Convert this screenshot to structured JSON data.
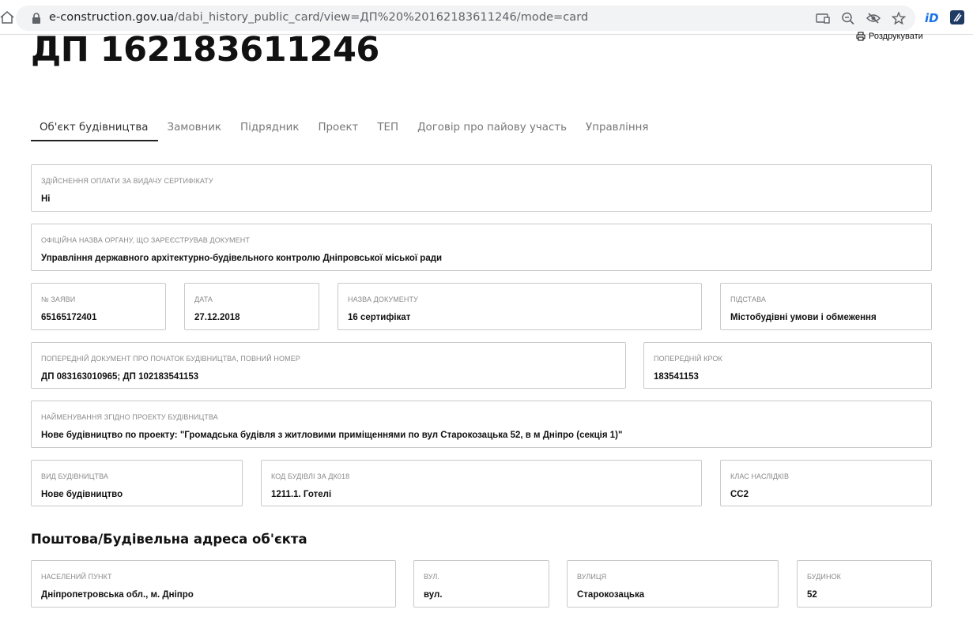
{
  "browser": {
    "url_host": "e-construction.gov.ua",
    "url_path": "/dabi_history_public_card/view=ДП%20%20162183611246/mode=card",
    "ext_icon_1": "iD"
  },
  "page": {
    "title": "ДП 162183611246",
    "print_label": "Роздрукувати"
  },
  "tabs": [
    {
      "label": "Об'єкт будівництва",
      "active": true
    },
    {
      "label": "Замовник"
    },
    {
      "label": "Підрядник"
    },
    {
      "label": "Проект"
    },
    {
      "label": "ТЕП"
    },
    {
      "label": "Договір про пайову участь"
    },
    {
      "label": "Управління"
    }
  ],
  "fields": {
    "payment": {
      "label": "Здійснення оплати за видачу сертифікату",
      "value": "Ні"
    },
    "authority": {
      "label": "Офіційна назва органу, що зареєстрував документ",
      "value": "Управління державного архітектурно-будівельного контролю Дніпровської міської ради"
    },
    "application_no": {
      "label": "№ заяви",
      "value": "65165172401"
    },
    "date": {
      "label": "Дата",
      "value": "27.12.2018"
    },
    "doc_name": {
      "label": "Назва документу",
      "value": "16 сертифікат"
    },
    "basis": {
      "label": "Підстава",
      "value": "Містобудівні умови і обмеження"
    },
    "prev_doc": {
      "label": "Попередній документ про початок будівництва, повний номер",
      "value": "ДП 083163010965; ДП 102183541153"
    },
    "prev_step": {
      "label": "Попередній крок",
      "value": "183541153"
    },
    "project_name": {
      "label": "Найменування згідно проекту будівництва",
      "value": "Нове будівництво по проекту: \"Громадська будівля з житловими приміщеннями по вул Старокозацька 52, в м Дніпро (секція 1)\""
    },
    "construction_type": {
      "label": "Вид будівництва",
      "value": "Нове будівництво"
    },
    "building_code": {
      "label": "Код будівлі за ДК018",
      "value": "1211.1. Готелі"
    },
    "consequence_class": {
      "label": "Клас наслідків",
      "value": "СС2"
    }
  },
  "address": {
    "title": "Поштова/Будівельна адреса об'єкта",
    "settlement": {
      "label": "Населений пункт",
      "value": "Дніпропетровська обл., м. Дніпро"
    },
    "street_type": {
      "label": "Вул.",
      "value": "вул."
    },
    "street": {
      "label": "Вулиця",
      "value": "Старокозацька"
    },
    "house": {
      "label": "Будинок",
      "value": "52"
    }
  },
  "colors": {
    "border": "#c9c9c9",
    "active_tab": "#222222",
    "ext_blue": "#1a73e8"
  }
}
